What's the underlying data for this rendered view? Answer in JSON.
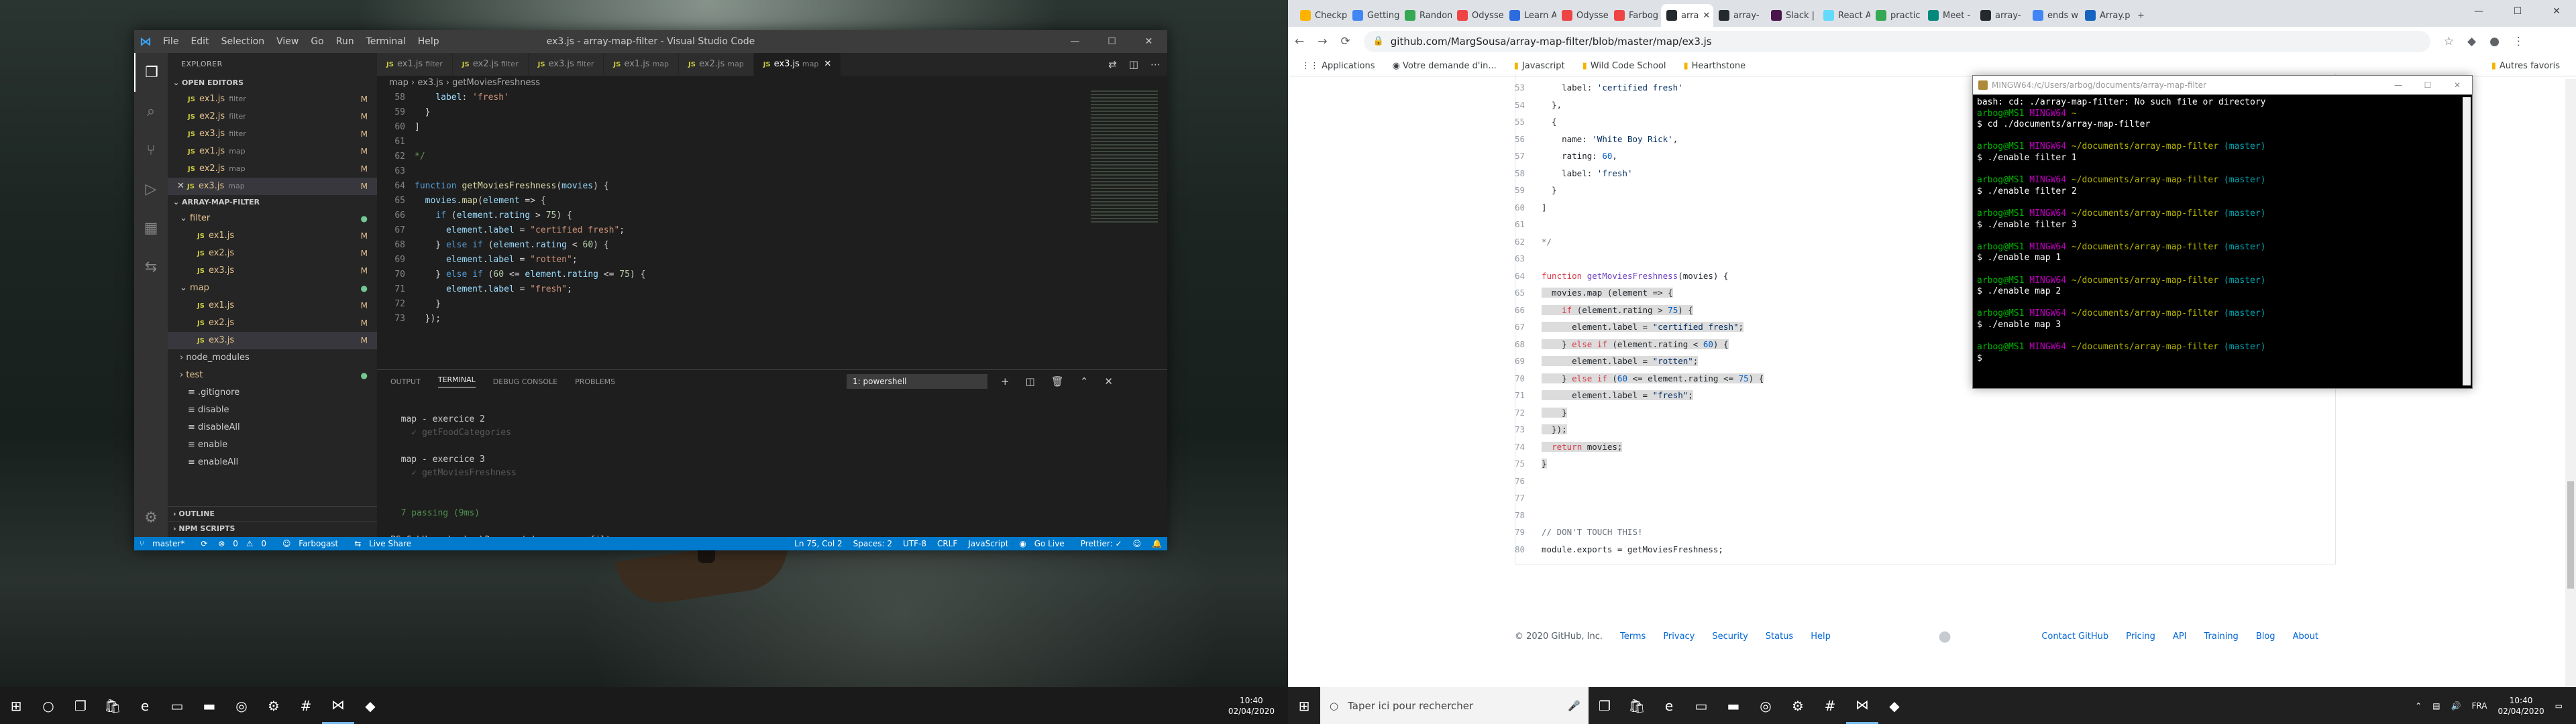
{
  "vscode": {
    "window_title": "ex3.js - array-map-filter - Visual Studio Code",
    "menu": [
      "File",
      "Edit",
      "Selection",
      "View",
      "Go",
      "Run",
      "Terminal",
      "Help"
    ],
    "explorer_title": "EXPLORER",
    "open_editors_label": "OPEN EDITORS",
    "open_editors": [
      {
        "name": "ex1.js",
        "desc": "filter",
        "status": "M"
      },
      {
        "name": "ex2.js",
        "desc": "filter",
        "status": "M"
      },
      {
        "name": "ex3.js",
        "desc": "filter",
        "status": "M"
      },
      {
        "name": "ex1.js",
        "desc": "map",
        "status": "M"
      },
      {
        "name": "ex2.js",
        "desc": "map",
        "status": "M"
      },
      {
        "name": "ex3.js",
        "desc": "map",
        "status": "M"
      }
    ],
    "project_label": "ARRAY-MAP-FILTER",
    "tree": [
      {
        "name": "filter",
        "type": "folder",
        "status": "●"
      },
      {
        "name": "ex1.js",
        "type": "js",
        "status": "M"
      },
      {
        "name": "ex2.js",
        "type": "js",
        "status": "M"
      },
      {
        "name": "ex3.js",
        "type": "js",
        "status": "M"
      },
      {
        "name": "map",
        "type": "folder",
        "status": "●"
      },
      {
        "name": "ex1.js",
        "type": "js",
        "status": "M"
      },
      {
        "name": "ex2.js",
        "type": "js",
        "status": "M"
      },
      {
        "name": "ex3.js",
        "type": "js",
        "status": "M"
      },
      {
        "name": "node_modules",
        "type": "folder",
        "status": ""
      },
      {
        "name": "test",
        "type": "folder",
        "status": "●"
      },
      {
        "name": ".gitignore",
        "type": "file",
        "status": ""
      },
      {
        "name": "disable",
        "type": "file",
        "status": ""
      },
      {
        "name": "disableAll",
        "type": "file",
        "status": ""
      },
      {
        "name": "enable",
        "type": "file",
        "status": ""
      },
      {
        "name": "enableAll",
        "type": "file",
        "status": ""
      }
    ],
    "outline_label": "OUTLINE",
    "npm_label": "NPM SCRIPTS",
    "tabs": [
      {
        "name": "ex1.js",
        "desc": "filter"
      },
      {
        "name": "ex2.js",
        "desc": "filter"
      },
      {
        "name": "ex3.js",
        "desc": "filter"
      },
      {
        "name": "ex1.js",
        "desc": "map"
      },
      {
        "name": "ex2.js",
        "desc": "map"
      },
      {
        "name": "ex3.js",
        "desc": "map"
      }
    ],
    "breadcrumb": [
      "map",
      "ex3.js",
      "getMoviesFreshness"
    ],
    "code_lines": [
      {
        "n": "58",
        "t": "    label: 'fresh'"
      },
      {
        "n": "59",
        "t": "  }"
      },
      {
        "n": "60",
        "t": "]"
      },
      {
        "n": "61",
        "t": ""
      },
      {
        "n": "62",
        "t": "*/"
      },
      {
        "n": "63",
        "t": ""
      },
      {
        "n": "64",
        "t": "function getMoviesFreshness(movies) {"
      },
      {
        "n": "65",
        "t": "  movies.map(element => {"
      },
      {
        "n": "66",
        "t": "    if (element.rating > 75) {"
      },
      {
        "n": "67",
        "t": "      element.label = \"certified fresh\";"
      },
      {
        "n": "68",
        "t": "    } else if (element.rating < 60) {"
      },
      {
        "n": "69",
        "t": "      element.label = \"rotten\";"
      },
      {
        "n": "70",
        "t": "    } else if (60 <= element.rating <= 75) {"
      },
      {
        "n": "71",
        "t": "      element.label = \"fresh\";"
      },
      {
        "n": "72",
        "t": "    }"
      },
      {
        "n": "73",
        "t": "  });"
      }
    ],
    "panel_tabs": [
      "OUTPUT",
      "TERMINAL",
      "DEBUG CONSOLE",
      "PROBLEMS"
    ],
    "terminal_select": "1: powershell",
    "terminal_lines": [
      "",
      "  map - exercice 2",
      "    ✓ getFoodCategories",
      "",
      "  map - exercice 3",
      "    ✓ getMoviesFreshness",
      "",
      "",
      "  7 passing (9ms)",
      "",
      "PS C:\\Users\\arbog\\Documents\\array-map-filter> "
    ],
    "status": {
      "branch": "master*",
      "errors": "0",
      "warnings": "0",
      "user": "Farbogast",
      "liveshare": "Live Share",
      "pos": "Ln 75, Col 2",
      "spaces": "Spaces: 2",
      "enc": "UTF-8",
      "eol": "CRLF",
      "lang": "JavaScript",
      "golive": "Go Live",
      "prettier": "Prettier: ✓"
    }
  },
  "chrome": {
    "tabs": [
      "Checkp",
      "Getting",
      "Random",
      "Odysse",
      "Learn A",
      "Odysse",
      "Farbog",
      "arra",
      "array-",
      "Slack |",
      "React A",
      "practic",
      "Meet -",
      "array-",
      "ends w",
      "Array.p"
    ],
    "url": "github.com/MargSousa/array-map-filter/blob/master/map/ex3.js",
    "bookmarks": [
      "Applications",
      "Votre demande d'in...",
      "Javascript",
      "Wild Code School",
      "Hearthstone",
      "Autres favoris"
    ],
    "code_lines": [
      {
        "n": "53",
        "t": "    label: 'certified fresh'",
        "h": false
      },
      {
        "n": "54",
        "t": "  },",
        "h": false
      },
      {
        "n": "55",
        "t": "  {",
        "h": false
      },
      {
        "n": "56",
        "t": "    name: 'White Boy Rick',",
        "h": false
      },
      {
        "n": "57",
        "t": "    rating: 60,",
        "h": false
      },
      {
        "n": "58",
        "t": "    label: 'fresh'",
        "h": false
      },
      {
        "n": "59",
        "t": "  }",
        "h": false
      },
      {
        "n": "60",
        "t": "]",
        "h": false
      },
      {
        "n": "61",
        "t": "",
        "h": false
      },
      {
        "n": "62",
        "t": "*/",
        "h": false
      },
      {
        "n": "63",
        "t": "",
        "h": false
      },
      {
        "n": "64",
        "t": "function getMoviesFreshness(movies) {",
        "h": false
      },
      {
        "n": "65",
        "t": "  movies.map (element => {",
        "h": true
      },
      {
        "n": "66",
        "t": "    if (element.rating > 75) {",
        "h": true
      },
      {
        "n": "67",
        "t": "      element.label = \"certified fresh\";",
        "h": true
      },
      {
        "n": "68",
        "t": "    } else if (element.rating < 60) {",
        "h": true
      },
      {
        "n": "69",
        "t": "      element.label = \"rotten\";",
        "h": true
      },
      {
        "n": "70",
        "t": "    } else if (60 <= element.rating <= 75) {",
        "h": true
      },
      {
        "n": "71",
        "t": "      element.label = \"fresh\";",
        "h": true
      },
      {
        "n": "72",
        "t": "    }",
        "h": true
      },
      {
        "n": "73",
        "t": "  });",
        "h": true
      },
      {
        "n": "74",
        "t": "  return movies;",
        "h": true
      },
      {
        "n": "75",
        "t": "}",
        "h": true
      },
      {
        "n": "76",
        "t": "",
        "h": false
      },
      {
        "n": "77",
        "t": "",
        "h": false
      },
      {
        "n": "78",
        "t": "",
        "h": false
      },
      {
        "n": "79",
        "t": "// DON'T TOUCH THIS!",
        "h": false
      },
      {
        "n": "80",
        "t": "module.exports = getMoviesFreshness;",
        "h": false
      }
    ],
    "footer_copy": "© 2020 GitHub, Inc.",
    "footer_left": [
      "Terms",
      "Privacy",
      "Security",
      "Status",
      "Help"
    ],
    "footer_right": [
      "Contact GitHub",
      "Pricing",
      "API",
      "Training",
      "Blog",
      "About"
    ]
  },
  "gitbash": {
    "title": "MINGW64:/c/Users/arbog/documents/array-map-filter",
    "lines": [
      {
        "t": "bash: cd: ./array-map-filter: No such file or directory",
        "k": "out"
      },
      {
        "t": "",
        "k": "prompt",
        "path": "~"
      },
      {
        "t": "$ cd ./documents/array-map-filter",
        "k": "out"
      },
      {
        "t": "",
        "k": "blank"
      },
      {
        "t": "",
        "k": "prompt",
        "path": "~/documents/array-map-filter",
        "br": "(master)"
      },
      {
        "t": "$ ./enable filter 1",
        "k": "out"
      },
      {
        "t": "",
        "k": "blank"
      },
      {
        "t": "",
        "k": "prompt",
        "path": "~/documents/array-map-filter",
        "br": "(master)"
      },
      {
        "t": "$ ./enable filter 2",
        "k": "out"
      },
      {
        "t": "",
        "k": "blank"
      },
      {
        "t": "",
        "k": "prompt",
        "path": "~/documents/array-map-filter",
        "br": "(master)"
      },
      {
        "t": "$ ./enable filter 3",
        "k": "out"
      },
      {
        "t": "",
        "k": "blank"
      },
      {
        "t": "",
        "k": "prompt",
        "path": "~/documents/array-map-filter",
        "br": "(master)"
      },
      {
        "t": "$ ./enable map 1",
        "k": "out"
      },
      {
        "t": "",
        "k": "blank"
      },
      {
        "t": "",
        "k": "prompt",
        "path": "~/documents/array-map-filter",
        "br": "(master)"
      },
      {
        "t": "$ ./enable map 2",
        "k": "out"
      },
      {
        "t": "",
        "k": "blank"
      },
      {
        "t": "",
        "k": "prompt",
        "path": "~/documents/array-map-filter",
        "br": "(master)"
      },
      {
        "t": "$ ./enable map 3",
        "k": "out"
      },
      {
        "t": "",
        "k": "blank"
      },
      {
        "t": "",
        "k": "prompt",
        "path": "~/documents/array-map-filter",
        "br": "(master)"
      },
      {
        "t": "$ ",
        "k": "out"
      }
    ],
    "user": "arbog@MS1",
    "host": "MINGW64"
  },
  "taskbar": {
    "left_time": "10:40",
    "left_date": "02/04/2020",
    "search_placeholder": "Taper ici pour rechercher",
    "right_time": "10:40",
    "right_date": "02/04/2020",
    "lang": "FRA"
  }
}
